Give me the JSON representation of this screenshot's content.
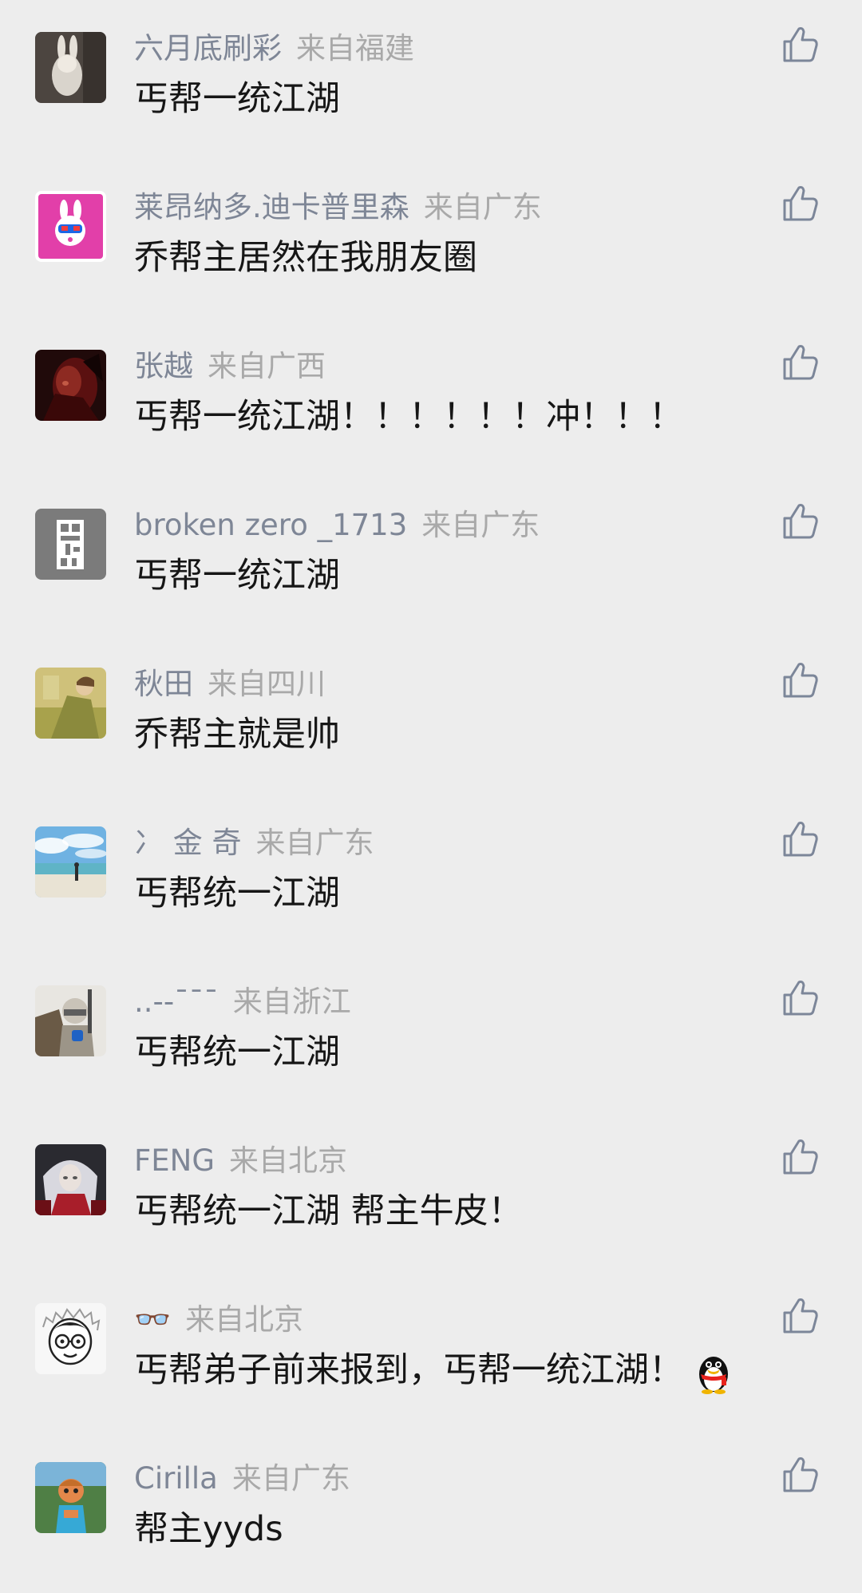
{
  "colors": {
    "background": "#ededed",
    "name": "#7e8696",
    "location": "#a9a9a9",
    "text": "#161616",
    "like_icon": "#7c8699"
  },
  "like_icon": "thumbs-up-icon",
  "comments": [
    {
      "name": "六月底刷彩",
      "location": "来自福建",
      "text": "丐帮一统江湖",
      "avatar": "dark-bunny-figure"
    },
    {
      "name": "莱昂纳多.迪卡普里森",
      "location": "来自广东",
      "text": "乔帮主居然在我朋友圈",
      "avatar": "pink-rabbit-mask"
    },
    {
      "name": "张越",
      "location": "来自广西",
      "text": "丐帮一统江湖！！！！！！冲！！！",
      "avatar": "dark-red-portrait"
    },
    {
      "name": "broken zero _1713",
      "location": "来自广东",
      "text": "丐帮一统江湖",
      "avatar": "gray-qr-pattern"
    },
    {
      "name": "秋田",
      "location": "来自四川",
      "text": "乔帮主就是帅",
      "avatar": "yellow-painting"
    },
    {
      "name": "冫 金 奇",
      "location": "来自广东",
      "text": "丐帮统一江湖",
      "avatar": "beach-sky"
    },
    {
      "name": "..--¯¯¯",
      "location": "来自浙江",
      "text": "丐帮统一江湖",
      "avatar": "armored-knight"
    },
    {
      "name": "FENG",
      "location": "来自北京",
      "text": "丐帮统一江湖 帮主牛皮！",
      "avatar": "white-haired-warrior"
    },
    {
      "name": "👓",
      "location": "来自北京",
      "text": "丐帮弟子前来报到，丐帮一统江湖！",
      "avatar": "cartoon-glasses-face",
      "emoji": "penguin-icon"
    },
    {
      "name": "Cirilla",
      "location": "来自广东",
      "text": "帮主yyds",
      "avatar": "game-character"
    }
  ]
}
